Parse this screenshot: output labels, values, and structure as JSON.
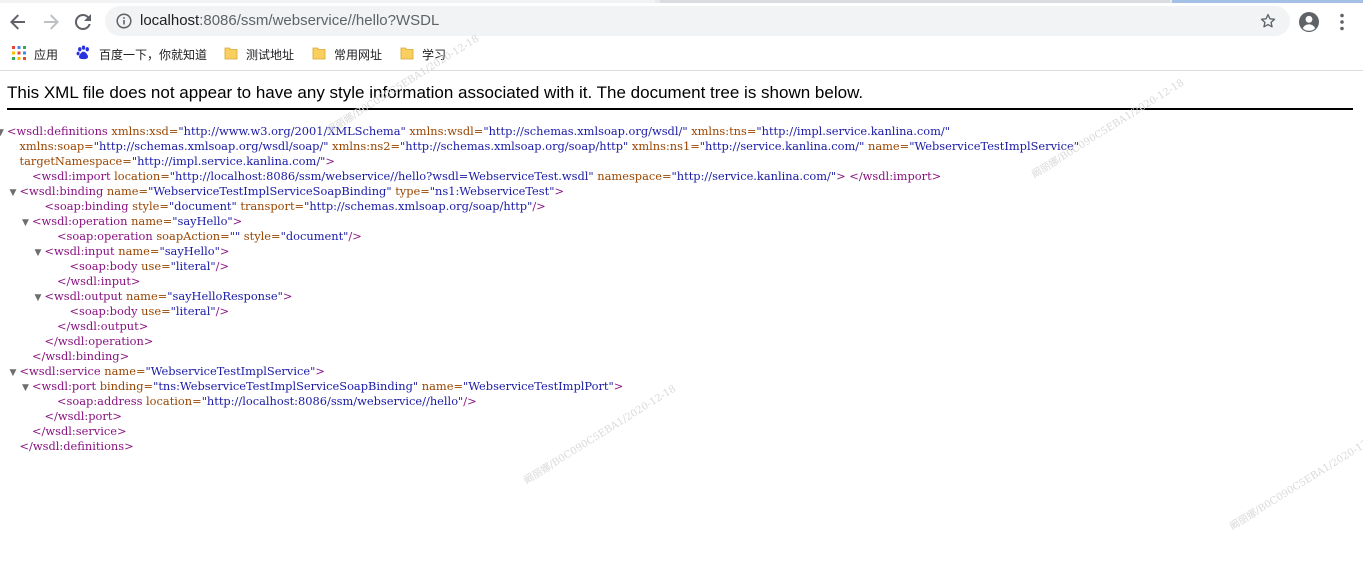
{
  "browser": {
    "url_host": "localhost",
    "url_rest": ":8086/ssm/webservice//hello?WSDL",
    "bookmarks": [
      {
        "label": "应用",
        "icon": "apps-grid-icon"
      },
      {
        "label": "百度一下，你就知道",
        "icon": "baidu-paw-icon"
      },
      {
        "label": "测试地址",
        "icon": "folder-icon"
      },
      {
        "label": "常用网址",
        "icon": "folder-icon"
      },
      {
        "label": "学习",
        "icon": "folder-icon"
      }
    ]
  },
  "page": {
    "banner": "This XML file does not appear to have any style information associated with it. The document tree is shown below."
  },
  "xml_lines": [
    {
      "indent": 0,
      "toggle": true,
      "tokens": [
        {
          "t": "tag",
          "v": "<wsdl:definitions"
        },
        {
          "t": "an",
          "v": " xmlns:xsd="
        },
        {
          "t": "av",
          "v": "\"http://www.w3.org/2001/XMLSchema\""
        },
        {
          "t": "an",
          "v": " xmlns:wsdl="
        },
        {
          "t": "av",
          "v": "\"http://schemas.xmlsoap.org/wsdl/\""
        },
        {
          "t": "an",
          "v": " xmlns:tns="
        },
        {
          "t": "av",
          "v": "\"http://impl.service.kanlina.com/\""
        }
      ]
    },
    {
      "indent": 1,
      "toggle": false,
      "tokens": [
        {
          "t": "an",
          "v": "xmlns:soap="
        },
        {
          "t": "av",
          "v": "\"http://schemas.xmlsoap.org/wsdl/soap/\""
        },
        {
          "t": "an",
          "v": " xmlns:ns2="
        },
        {
          "t": "av",
          "v": "\"http://schemas.xmlsoap.org/soap/http\""
        },
        {
          "t": "an",
          "v": " xmlns:ns1="
        },
        {
          "t": "av",
          "v": "\"http://service.kanlina.com/\""
        },
        {
          "t": "an",
          "v": " name="
        },
        {
          "t": "av",
          "v": "\"WebserviceTestImplService\""
        }
      ]
    },
    {
      "indent": 1,
      "toggle": false,
      "tokens": [
        {
          "t": "an",
          "v": "targetNamespace="
        },
        {
          "t": "av",
          "v": "\"http://impl.service.kanlina.com/\""
        },
        {
          "t": "tag",
          "v": ">"
        }
      ]
    },
    {
      "indent": 2,
      "toggle": false,
      "tokens": [
        {
          "t": "tag",
          "v": "<wsdl:import"
        },
        {
          "t": "an",
          "v": " location="
        },
        {
          "t": "av",
          "v": "\"http://localhost:8086/ssm/webservice//hello?wsdl=WebserviceTest.wsdl\""
        },
        {
          "t": "an",
          "v": " namespace="
        },
        {
          "t": "av",
          "v": "\"http://service.kanlina.com/\""
        },
        {
          "t": "tag",
          "v": "> </wsdl:import>"
        }
      ]
    },
    {
      "indent": 1,
      "toggle": true,
      "tokens": [
        {
          "t": "tag",
          "v": "<wsdl:binding"
        },
        {
          "t": "an",
          "v": " name="
        },
        {
          "t": "av",
          "v": "\"WebserviceTestImplServiceSoapBinding\""
        },
        {
          "t": "an",
          "v": " type="
        },
        {
          "t": "av",
          "v": "\"ns1:WebserviceTest\""
        },
        {
          "t": "tag",
          "v": ">"
        }
      ]
    },
    {
      "indent": 3,
      "toggle": false,
      "tokens": [
        {
          "t": "tag",
          "v": "<soap:binding"
        },
        {
          "t": "an",
          "v": " style="
        },
        {
          "t": "av",
          "v": "\"document\""
        },
        {
          "t": "an",
          "v": " transport="
        },
        {
          "t": "av",
          "v": "\"http://schemas.xmlsoap.org/soap/http\""
        },
        {
          "t": "tag",
          "v": "/>"
        }
      ]
    },
    {
      "indent": 2,
      "toggle": true,
      "tokens": [
        {
          "t": "tag",
          "v": "<wsdl:operation"
        },
        {
          "t": "an",
          "v": " name="
        },
        {
          "t": "av",
          "v": "\"sayHello\""
        },
        {
          "t": "tag",
          "v": ">"
        }
      ]
    },
    {
      "indent": 4,
      "toggle": false,
      "tokens": [
        {
          "t": "tag",
          "v": "<soap:operation"
        },
        {
          "t": "an",
          "v": " soapAction="
        },
        {
          "t": "av",
          "v": "\"\""
        },
        {
          "t": "an",
          "v": " style="
        },
        {
          "t": "av",
          "v": "\"document\""
        },
        {
          "t": "tag",
          "v": "/>"
        }
      ]
    },
    {
      "indent": 3,
      "toggle": true,
      "tokens": [
        {
          "t": "tag",
          "v": "<wsdl:input"
        },
        {
          "t": "an",
          "v": " name="
        },
        {
          "t": "av",
          "v": "\"sayHello\""
        },
        {
          "t": "tag",
          "v": ">"
        }
      ]
    },
    {
      "indent": 5,
      "toggle": false,
      "tokens": [
        {
          "t": "tag",
          "v": "<soap:body"
        },
        {
          "t": "an",
          "v": " use="
        },
        {
          "t": "av",
          "v": "\"literal\""
        },
        {
          "t": "tag",
          "v": "/>"
        }
      ]
    },
    {
      "indent": 4,
      "toggle": false,
      "tokens": [
        {
          "t": "tag",
          "v": "</wsdl:input>"
        }
      ]
    },
    {
      "indent": 3,
      "toggle": true,
      "tokens": [
        {
          "t": "tag",
          "v": "<wsdl:output"
        },
        {
          "t": "an",
          "v": " name="
        },
        {
          "t": "av",
          "v": "\"sayHelloResponse\""
        },
        {
          "t": "tag",
          "v": ">"
        }
      ]
    },
    {
      "indent": 5,
      "toggle": false,
      "tokens": [
        {
          "t": "tag",
          "v": "<soap:body"
        },
        {
          "t": "an",
          "v": " use="
        },
        {
          "t": "av",
          "v": "\"literal\""
        },
        {
          "t": "tag",
          "v": "/>"
        }
      ]
    },
    {
      "indent": 4,
      "toggle": false,
      "tokens": [
        {
          "t": "tag",
          "v": "</wsdl:output>"
        }
      ]
    },
    {
      "indent": 3,
      "toggle": false,
      "tokens": [
        {
          "t": "tag",
          "v": "</wsdl:operation>"
        }
      ]
    },
    {
      "indent": 2,
      "toggle": false,
      "tokens": [
        {
          "t": "tag",
          "v": "</wsdl:binding>"
        }
      ]
    },
    {
      "indent": 1,
      "toggle": true,
      "tokens": [
        {
          "t": "tag",
          "v": "<wsdl:service"
        },
        {
          "t": "an",
          "v": " name="
        },
        {
          "t": "av",
          "v": "\"WebserviceTestImplService\""
        },
        {
          "t": "tag",
          "v": ">"
        }
      ]
    },
    {
      "indent": 2,
      "toggle": true,
      "tokens": [
        {
          "t": "tag",
          "v": "<wsdl:port"
        },
        {
          "t": "an",
          "v": " binding="
        },
        {
          "t": "av",
          "v": "\"tns:WebserviceTestImplServiceSoapBinding\""
        },
        {
          "t": "an",
          "v": " name="
        },
        {
          "t": "av",
          "v": "\"WebserviceTestImplPort\""
        },
        {
          "t": "tag",
          "v": ">"
        }
      ]
    },
    {
      "indent": 4,
      "toggle": false,
      "tokens": [
        {
          "t": "tag",
          "v": "<soap:address"
        },
        {
          "t": "an",
          "v": " location="
        },
        {
          "t": "av",
          "v": "\"http://localhost:8086/ssm/webservice//hello\""
        },
        {
          "t": "tag",
          "v": "/>"
        }
      ]
    },
    {
      "indent": 3,
      "toggle": false,
      "tokens": [
        {
          "t": "tag",
          "v": "</wsdl:port>"
        }
      ]
    },
    {
      "indent": 2,
      "toggle": false,
      "tokens": [
        {
          "t": "tag",
          "v": "</wsdl:service>"
        }
      ]
    },
    {
      "indent": 1,
      "toggle": false,
      "tokens": [
        {
          "t": "tag",
          "v": "</wsdl:definitions>"
        }
      ]
    }
  ],
  "watermark": "阚丽娜/B0C090C5EBA1/2020-12-18",
  "colors": {
    "tag": "#881280",
    "attr_name": "#994500",
    "attr_value": "#1a1aa6"
  }
}
